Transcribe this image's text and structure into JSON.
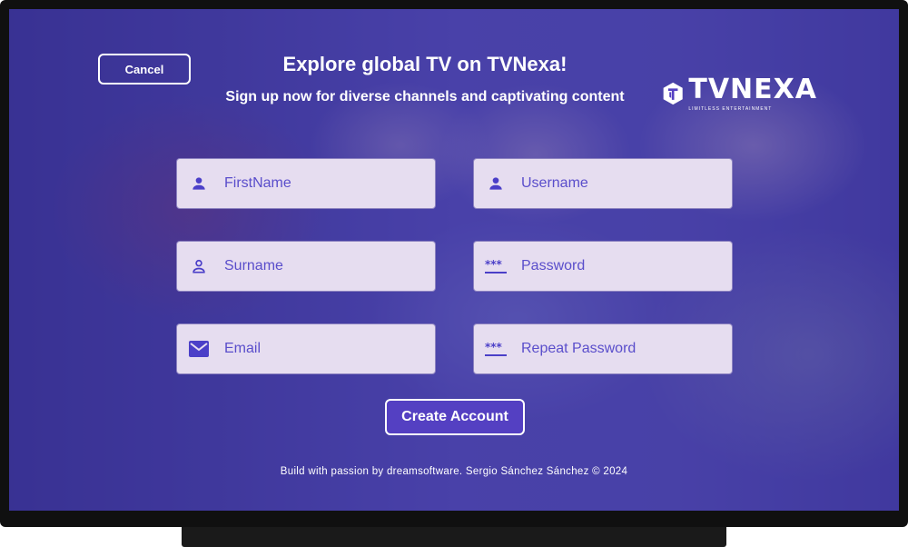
{
  "header": {
    "cancel_label": "Cancel",
    "title": "Explore global TV on TVNexa!",
    "subtitle": "Sign up now for diverse channels and captivating content"
  },
  "logo": {
    "name": "TVNEXA",
    "tagline": "LIMITLESS ENTERTAINMENT"
  },
  "form": {
    "firstname": {
      "placeholder": "FirstName",
      "icon": "person-icon"
    },
    "username": {
      "placeholder": "Username",
      "icon": "person-icon"
    },
    "surname": {
      "placeholder": "Surname",
      "icon": "person-outline-icon"
    },
    "password": {
      "placeholder": "Password",
      "icon": "password-icon"
    },
    "email": {
      "placeholder": "Email",
      "icon": "mail-icon"
    },
    "repeat_password": {
      "placeholder": "Repeat Password",
      "icon": "password-icon"
    },
    "submit_label": "Create Account"
  },
  "footer": {
    "text": "Build with passion by dreamsoftware. Sergio Sánchez Sánchez © 2024"
  },
  "colors": {
    "accent": "#5440c2",
    "field_bg": "#e6ddf0",
    "field_text": "#4b3fc8"
  }
}
